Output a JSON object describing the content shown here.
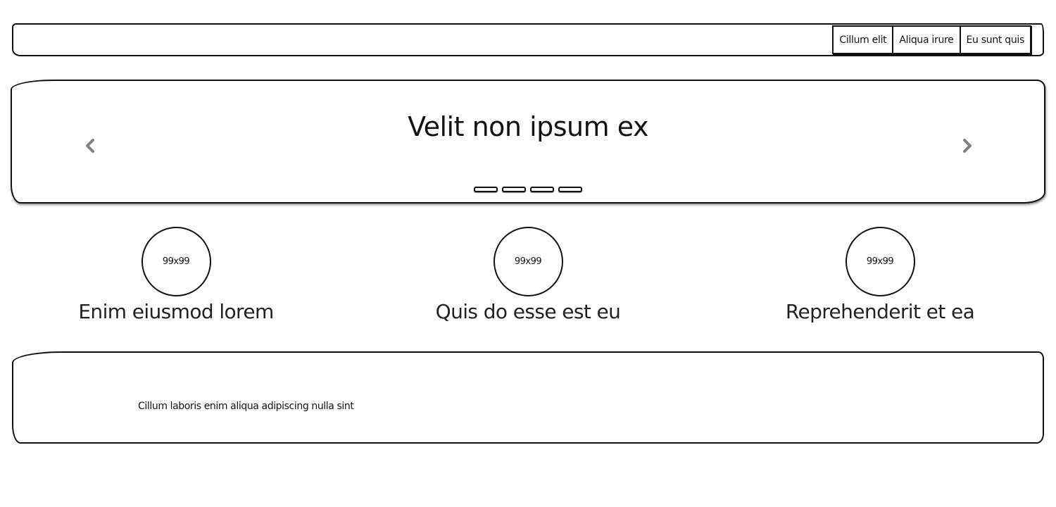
{
  "navbar": {
    "items": [
      {
        "label": "Cillum elit"
      },
      {
        "label": "Aliqua irure"
      },
      {
        "label": "Eu sunt quis"
      }
    ]
  },
  "hero": {
    "title": "Velit non ipsum ex",
    "prev_icon": "chevron-left-icon",
    "next_icon": "chevron-right-icon",
    "slide_count": 4,
    "active_slide": 1,
    "arrow_color": "#808080"
  },
  "features": [
    {
      "image_label": "99x99",
      "title": "Enim eiusmod lorem"
    },
    {
      "image_label": "99x99",
      "title": "Quis do esse est eu"
    },
    {
      "image_label": "99x99",
      "title": "Reprehenderit et ea"
    }
  ],
  "panel": {
    "text": "Cillum laboris enim aliqua adipiscing nulla sint"
  }
}
